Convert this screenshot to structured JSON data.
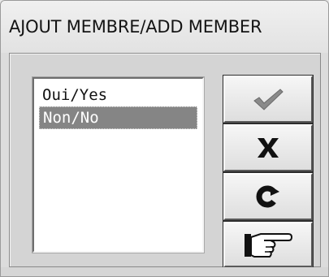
{
  "window": {
    "title": "AJOUT MEMBRE/ADD MEMBER"
  },
  "listbox": {
    "items": [
      {
        "label": "Oui/Yes",
        "selected": false
      },
      {
        "label": "Non/No",
        "selected": true
      }
    ]
  },
  "buttons": [
    {
      "icon": "checkmark-icon"
    },
    {
      "icon": "cancel-x-icon"
    },
    {
      "icon": "refresh-icon"
    },
    {
      "icon": "pointing-hand-icon"
    }
  ],
  "colors": {
    "selection_background": "#858585",
    "selection_text": "#ffffff",
    "dialog_background": "#d4d4d4"
  }
}
